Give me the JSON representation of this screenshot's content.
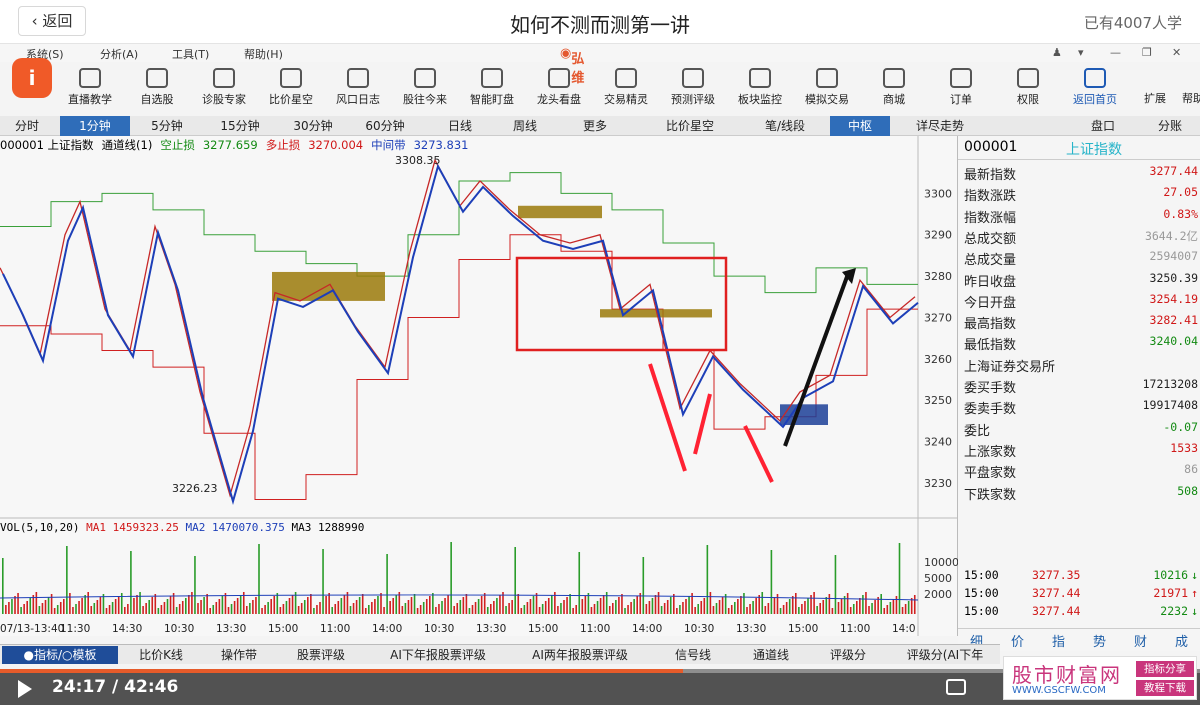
{
  "header": {
    "back_label": "返回",
    "title": "如何不测而测第一讲",
    "learners": "已有4007人学"
  },
  "app": {
    "brand": "弘维",
    "menu": [
      "系统(S)",
      "分析(A)",
      "工具(T)",
      "帮助(H)"
    ],
    "toolbar": [
      "直播教学",
      "自选股",
      "诊股专家",
      "比价星空",
      "风口日志",
      "股往今来",
      "智能盯盘",
      "龙头看盘",
      "交易精灵",
      "预测评级",
      "板块监控",
      "模拟交易",
      "商城",
      "订单",
      "权限",
      "返回首页"
    ],
    "toolbar_right": [
      "扩展",
      "帮助"
    ],
    "periods": [
      "分时",
      "1分钟",
      "5分钟",
      "15分钟",
      "30分钟",
      "60分钟",
      "日线",
      "周线",
      "更多",
      "比价星空",
      "笔/线段",
      "中枢",
      "详尽走势",
      "盘口",
      "分账"
    ],
    "selected_period": "1分钟",
    "highlight_period": "中枢"
  },
  "chart_info": {
    "code_name": "000001 上证指数",
    "indicator": "通道线(1)",
    "stop_empty_label": "空止损",
    "stop_empty_value": "3277.659",
    "stop_long_label": "多止损",
    "stop_long_value": "3270.004",
    "mid_label": "中间带",
    "mid_value": "3273.831",
    "high_label": "3308.35",
    "low_label": "3226.23",
    "vol_label": "VOL(5,10,20)",
    "ma1_label": "MA1",
    "ma1_value": "1459323.25",
    "ma2_label": "MA2",
    "ma2_value": "1470070.375",
    "ma3_label": "MA3",
    "ma3_value": "1288990",
    "vol_ticks": [
      "10000",
      "5000",
      "2000"
    ],
    "price_ticks": [
      "3300",
      "3290",
      "3280",
      "3270",
      "3260",
      "3250",
      "3240",
      "3230"
    ],
    "time_ticks": [
      "07/13-13:40",
      "11:30",
      "14:30",
      "10:30",
      "13:30",
      "15:00",
      "11:00",
      "14:00",
      "10:30",
      "13:30",
      "15:00",
      "11:00",
      "14:00",
      "10:30",
      "13:30",
      "15:00",
      "11:00",
      "14:0"
    ]
  },
  "side": {
    "code": "000001",
    "name": "上证指数",
    "rows": [
      {
        "label": "最新指数",
        "value": "3277.44",
        "color": "red"
      },
      {
        "label": "指数涨跌",
        "value": "27.05",
        "color": "red"
      },
      {
        "label": "指数涨幅",
        "value": "0.83%",
        "color": "red"
      },
      {
        "label": "总成交额",
        "value": "3644.2亿",
        "color": "grey"
      },
      {
        "label": "总成交量",
        "value": "2594007",
        "color": "grey"
      },
      {
        "label": "昨日收盘",
        "value": "3250.39",
        "color": "dark"
      },
      {
        "label": "今日开盘",
        "value": "3254.19",
        "color": "red"
      },
      {
        "label": "最高指数",
        "value": "3282.41",
        "color": "red"
      },
      {
        "label": "最低指数",
        "value": "3240.04",
        "color": "green"
      },
      {
        "label": "上海证券交易所",
        "value": "",
        "color": "dark"
      },
      {
        "label": "委买手数",
        "value": "17213208",
        "color": "dark"
      },
      {
        "label": "委卖手数",
        "value": "19917408",
        "color": "dark"
      },
      {
        "label": "委比",
        "value": "-0.07",
        "color": "green"
      },
      {
        "label": "上涨家数",
        "value": "1533",
        "color": "red"
      },
      {
        "label": "平盘家数",
        "value": "86",
        "color": "grey"
      },
      {
        "label": "下跌家数",
        "value": "508",
        "color": "green"
      }
    ],
    "ticks": [
      {
        "time": "15:00",
        "price": "3277.35",
        "vol": "10216",
        "dir": "↓",
        "color": "green"
      },
      {
        "time": "15:00",
        "price": "3277.44",
        "vol": "21971",
        "dir": "↑",
        "color": "red"
      },
      {
        "time": "15:00",
        "price": "3277.44",
        "vol": "2232",
        "dir": "↓",
        "color": "green"
      }
    ],
    "tabs": [
      "细",
      "价",
      "指",
      "势",
      "财",
      "成"
    ]
  },
  "bottom_tabs": [
    "●指标/○模板",
    "比价K线",
    "操作带",
    "股票评级",
    "AI下年报股票评级",
    "AI两年报股票评级",
    "信号线",
    "通道线",
    "评级分",
    "评级分(AI下年"
  ],
  "player": {
    "time": "24:17 / 42:46",
    "progress": 0.569
  },
  "watermark": {
    "title": "股市财富网",
    "url": "WWW.GSCFW.COM",
    "tag1": "指标分享",
    "tag2": "教程下载"
  },
  "chart_data": {
    "type": "candlestick-line",
    "title": "000001 上证指数 通道线(1)",
    "ylim": [
      3222,
      3310
    ],
    "y_ticks": [
      3300,
      3290,
      3280,
      3270,
      3260,
      3250,
      3240,
      3230
    ],
    "price_path": [
      {
        "x": 0,
        "y": 3282
      },
      {
        "x": 20,
        "y": 3272
      },
      {
        "x": 40,
        "y": 3261
      },
      {
        "x": 65,
        "y": 3290
      },
      {
        "x": 80,
        "y": 3298
      },
      {
        "x": 105,
        "y": 3272
      },
      {
        "x": 130,
        "y": 3262
      },
      {
        "x": 155,
        "y": 3292
      },
      {
        "x": 175,
        "y": 3278
      },
      {
        "x": 200,
        "y": 3252
      },
      {
        "x": 230,
        "y": 3227
      },
      {
        "x": 250,
        "y": 3244
      },
      {
        "x": 275,
        "y": 3276
      },
      {
        "x": 300,
        "y": 3274
      },
      {
        "x": 330,
        "y": 3278
      },
      {
        "x": 355,
        "y": 3268
      },
      {
        "x": 385,
        "y": 3258
      },
      {
        "x": 410,
        "y": 3286
      },
      {
        "x": 435,
        "y": 3308
      },
      {
        "x": 460,
        "y": 3297
      },
      {
        "x": 480,
        "y": 3303
      },
      {
        "x": 510,
        "y": 3296
      },
      {
        "x": 540,
        "y": 3290
      },
      {
        "x": 570,
        "y": 3288
      },
      {
        "x": 600,
        "y": 3290
      },
      {
        "x": 620,
        "y": 3272
      },
      {
        "x": 650,
        "y": 3278
      },
      {
        "x": 680,
        "y": 3248
      },
      {
        "x": 710,
        "y": 3262
      },
      {
        "x": 740,
        "y": 3254
      },
      {
        "x": 780,
        "y": 3245
      },
      {
        "x": 800,
        "y": 3252
      },
      {
        "x": 830,
        "y": 3256
      },
      {
        "x": 860,
        "y": 3279
      },
      {
        "x": 890,
        "y": 3270
      },
      {
        "x": 915,
        "y": 3275
      }
    ],
    "upper_channel": [
      3292,
      3298,
      3300,
      3296,
      3290,
      3286,
      3283,
      3280,
      3290,
      3303,
      3305,
      3300,
      3296,
      3288,
      3280,
      3276,
      3282,
      3278
    ],
    "lower_channel": [
      3268,
      3266,
      3262,
      3258,
      3242,
      3226,
      3232,
      3255,
      3270,
      3284,
      3290,
      3286,
      3272,
      3262,
      3243,
      3246,
      3256,
      3272
    ],
    "pivot_boxes": [
      {
        "x0": 272,
        "x1": 385,
        "y_low": 3274,
        "y_high": 3281
      },
      {
        "x0": 518,
        "x1": 602,
        "y_low": 3294,
        "y_high": 3297
      },
      {
        "x0": 600,
        "x1": 712,
        "y_low": 3270,
        "y_high": 3272
      },
      {
        "x0": 780,
        "x1": 828,
        "y_low": 3244,
        "y_high": 3249
      }
    ],
    "annotations": [
      "red box region",
      "red down arrows",
      "black up arrow"
    ],
    "volume": {
      "ma1": 1459323.25,
      "ma2": 1470070.375,
      "ma3": 1288990,
      "y_ticks": [
        10000,
        5000,
        2000
      ]
    }
  }
}
